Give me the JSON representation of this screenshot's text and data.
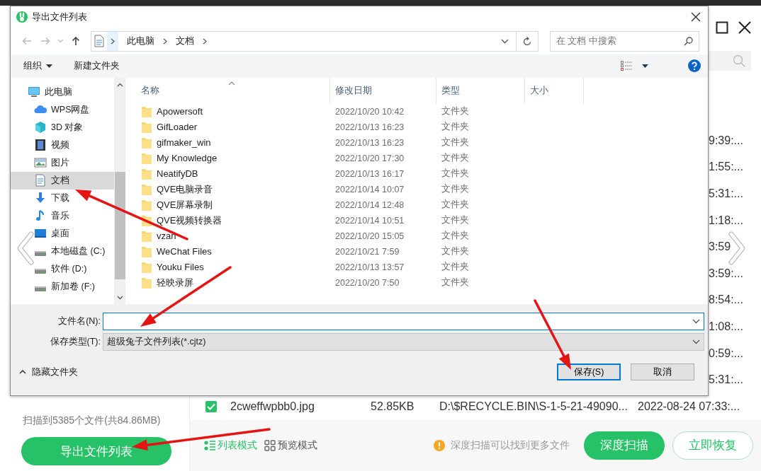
{
  "app": {
    "partial_times": [
      "9:39:...",
      "1:55:...",
      "5:31:...",
      "1:18:...",
      "3:59",
      "3:59:...",
      "8:54:...",
      "1:08:...",
      "0:59:...",
      "5:31:..."
    ],
    "file_rows": [
      {
        "checked": true,
        "name": "2cweffwpbb0.jpg",
        "size": "52.85KB",
        "path": "D:\\$RECYCLE.BIN\\S-1-5-21-49090...",
        "time": "2022-08-24 07:33:..."
      }
    ],
    "scan_summary": "扫描到5385个文件(共84.86MB)",
    "export_button": "导出文件列表",
    "view_modes": [
      {
        "label": "列表模式",
        "kind": "list",
        "selected": true
      },
      {
        "label": "预览模式",
        "kind": "grid",
        "selected": false
      }
    ],
    "hint": "深度扫描可以找到更多文件",
    "actions": [
      {
        "label": "深度扫描",
        "kind": "primary"
      },
      {
        "label": "立即恢复",
        "kind": "outline"
      }
    ]
  },
  "dialog": {
    "title": "导出文件列表",
    "breadcrumb": [
      "此电脑",
      "文档"
    ],
    "search": {
      "placeholder": "在 文档 中搜索"
    },
    "toolbar": [
      {
        "label": "组织",
        "dropdown": true
      },
      {
        "label": "新建文件夹",
        "dropdown": false
      }
    ],
    "nav": [
      {
        "label": "此电脑",
        "kind": "computer",
        "selected": false,
        "children": [
          {
            "label": "WPS网盘",
            "kind": "cloud",
            "selected": false
          },
          {
            "label": "3D 对象",
            "kind": "cube",
            "selected": false
          },
          {
            "label": "视频",
            "kind": "video",
            "selected": false
          },
          {
            "label": "图片",
            "kind": "picture",
            "selected": false
          },
          {
            "label": "文档",
            "kind": "document",
            "selected": true
          },
          {
            "label": "下载",
            "kind": "download",
            "selected": false
          },
          {
            "label": "音乐",
            "kind": "music",
            "selected": false
          },
          {
            "label": "桌面",
            "kind": "desktop",
            "selected": false
          },
          {
            "label": "本地磁盘 (C:)",
            "kind": "drive",
            "selected": false
          },
          {
            "label": "软件 (D:)",
            "kind": "drive",
            "selected": false
          },
          {
            "label": "新加卷 (F:)",
            "kind": "drive",
            "selected": false
          }
        ]
      }
    ],
    "columns": [
      "名称",
      "修改日期",
      "类型",
      "大小"
    ],
    "files": [
      {
        "name": "Apowersoft",
        "modified": "2022/10/20 10:42",
        "type": "文件夹"
      },
      {
        "name": "GifLoader",
        "modified": "2022/10/13 16:23",
        "type": "文件夹"
      },
      {
        "name": "gifmaker_win",
        "modified": "2022/10/13 16:23",
        "type": "文件夹"
      },
      {
        "name": "My Knowledge",
        "modified": "2022/10/20 17:30",
        "type": "文件夹"
      },
      {
        "name": "NeatifyDB",
        "modified": "2022/10/13 16:17",
        "type": "文件夹"
      },
      {
        "name": "QVE电脑录音",
        "modified": "2022/10/14 10:07",
        "type": "文件夹"
      },
      {
        "name": "QVE屏幕录制",
        "modified": "2022/10/14 12:48",
        "type": "文件夹"
      },
      {
        "name": "QVE视频转换器",
        "modified": "2022/10/14 10:51",
        "type": "文件夹"
      },
      {
        "name": "vzan",
        "modified": "2022/10/20 15:05",
        "type": "文件夹"
      },
      {
        "name": "WeChat Files",
        "modified": "2022/10/21 7:59",
        "type": "文件夹"
      },
      {
        "name": "Youku Files",
        "modified": "2022/10/13 13:57",
        "type": "文件夹"
      },
      {
        "name": "轻映录屏",
        "modified": "2022/10/20 7:50",
        "type": "文件夹"
      }
    ],
    "filename": {
      "label": "文件名(N):"
    },
    "save_type": {
      "label": "保存类型(T):",
      "value": "超级兔子文件列表(*.cjtz)"
    },
    "hide_folders": "隐藏文件夹",
    "buttons": [
      {
        "label": "保存(S)",
        "default": true
      },
      {
        "label": "取消",
        "default": false
      }
    ]
  }
}
